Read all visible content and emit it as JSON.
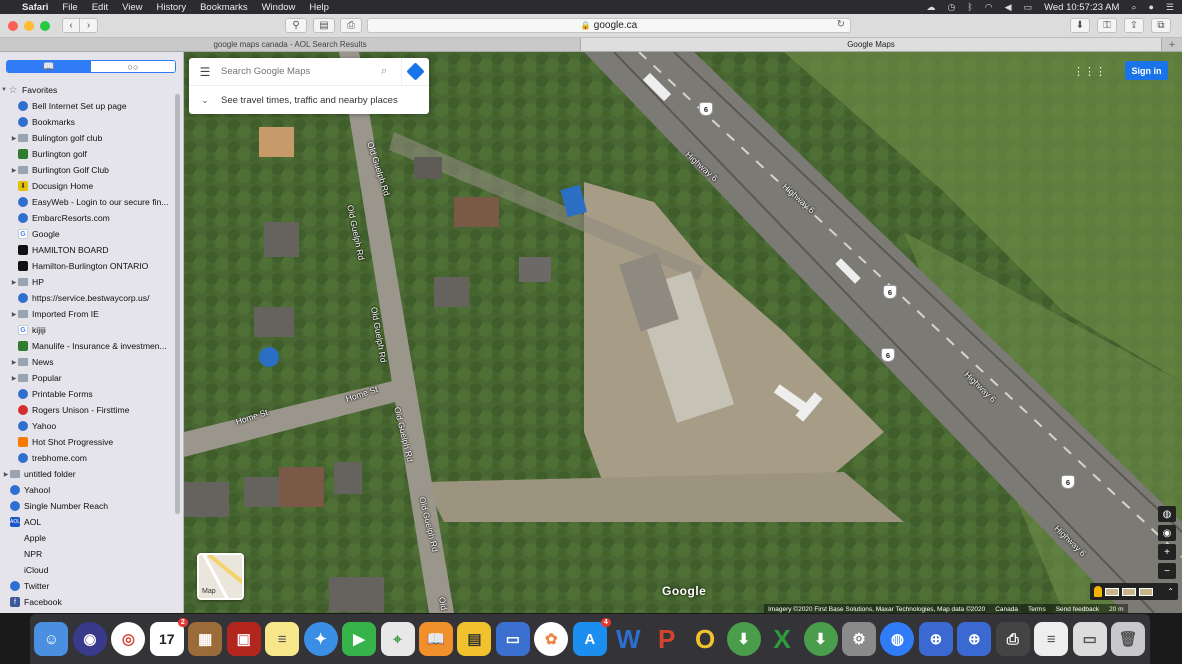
{
  "menubar": {
    "app": "Safari",
    "items": [
      "File",
      "Edit",
      "View",
      "History",
      "Bookmarks",
      "Window",
      "Help"
    ],
    "clock": "Wed 10:57:23 AM"
  },
  "toolbar": {
    "url": "google.ca"
  },
  "tabs": [
    {
      "label": "google maps canada - AOL Search Results",
      "active": false
    },
    {
      "label": "Google Maps",
      "active": true
    }
  ],
  "sidebar": {
    "favorites_label": "Favorites",
    "items": [
      {
        "label": "Bell Internet Set up page",
        "icon": "globe",
        "folder": false
      },
      {
        "label": "Bookmarks",
        "icon": "globe",
        "folder": false
      },
      {
        "label": "Bulington golf club",
        "icon": "folder",
        "folder": true
      },
      {
        "label": "Burlington golf",
        "icon": "green",
        "folder": false
      },
      {
        "label": "Burlington Golf Club",
        "icon": "folder",
        "folder": true
      },
      {
        "label": "Docusign Home",
        "icon": "dl",
        "folder": false
      },
      {
        "label": "EasyWeb - Login to our secure fin...",
        "icon": "globe",
        "folder": false
      },
      {
        "label": "EmbarcResorts.com",
        "icon": "globe",
        "folder": false
      },
      {
        "label": "Google",
        "icon": "g",
        "folder": false
      },
      {
        "label": "HAMILTON BOARD",
        "icon": "black",
        "folder": false
      },
      {
        "label": "Hamilton-Burlington ONTARIO",
        "icon": "black",
        "folder": false
      },
      {
        "label": "HP",
        "icon": "folder",
        "folder": true
      },
      {
        "label": "https://service.bestwaycorp.us/",
        "icon": "globe",
        "folder": false
      },
      {
        "label": "Imported From IE",
        "icon": "folder",
        "folder": true
      },
      {
        "label": "kijiji",
        "icon": "g",
        "folder": false
      },
      {
        "label": "Manulife - Insurance & investmen...",
        "icon": "green",
        "folder": false
      },
      {
        "label": "News",
        "icon": "folder",
        "folder": true
      },
      {
        "label": "Popular",
        "icon": "folder",
        "folder": true
      },
      {
        "label": "Printable Forms",
        "icon": "globe",
        "folder": false
      },
      {
        "label": "Rogers Unison - Firsttime",
        "icon": "red",
        "folder": false
      },
      {
        "label": "Yahoo",
        "icon": "globe",
        "folder": false
      },
      {
        "label": "Hot Shot Progressive",
        "icon": "orange",
        "folder": false
      },
      {
        "label": "trebhome.com",
        "icon": "globe",
        "folder": false
      }
    ],
    "top_items": [
      {
        "label": "untitled folder",
        "icon": "folder",
        "folder": true
      },
      {
        "label": "Yahool",
        "icon": "globe",
        "folder": false
      },
      {
        "label": "Single Number Reach",
        "icon": "globe",
        "folder": false
      },
      {
        "label": "AOL",
        "icon": "aol",
        "folder": false
      },
      {
        "label": "Apple",
        "icon": "apple",
        "folder": false
      },
      {
        "label": "NPR",
        "icon": "apple",
        "folder": false
      },
      {
        "label": "iCloud",
        "icon": "apple",
        "folder": false
      },
      {
        "label": "Twitter",
        "icon": "globe",
        "folder": false
      },
      {
        "label": "Facebook",
        "icon": "fb",
        "folder": false
      }
    ]
  },
  "map": {
    "search_placeholder": "Search Google Maps",
    "travel_times": "See travel times, traffic and nearby places",
    "sign_in": "Sign in",
    "google": "Google",
    "map_thumb": "Map",
    "labels": [
      {
        "text": "Old Guelph Rd",
        "key": "ogr1"
      },
      {
        "text": "Old Guelph Rd",
        "key": "ogr2"
      },
      {
        "text": "Old Guelph Rd",
        "key": "ogr3"
      },
      {
        "text": "Old Guelph Rd",
        "key": "ogr4"
      },
      {
        "text": "Old",
        "key": "ogr5"
      },
      {
        "text": "Home St",
        "key": "home1"
      },
      {
        "text": "Home St",
        "key": "home2"
      },
      {
        "text": "Highway 6",
        "key": "hwy1"
      },
      {
        "text": "Highway 6",
        "key": "hwy2"
      },
      {
        "text": "Highway 6",
        "key": "hwy3"
      },
      {
        "text": "Highway 6",
        "key": "hwy4"
      }
    ],
    "shield_number": "6",
    "attribution": [
      "Imagery ©2020 First Base Solutions, Maxar Technologies, Map data ©2020",
      "Canada",
      "Terms",
      "Send feedback",
      "20 m"
    ]
  },
  "dock": {
    "calendar_day": "17",
    "calendar_badge": "2",
    "appstore_badge": "4"
  }
}
